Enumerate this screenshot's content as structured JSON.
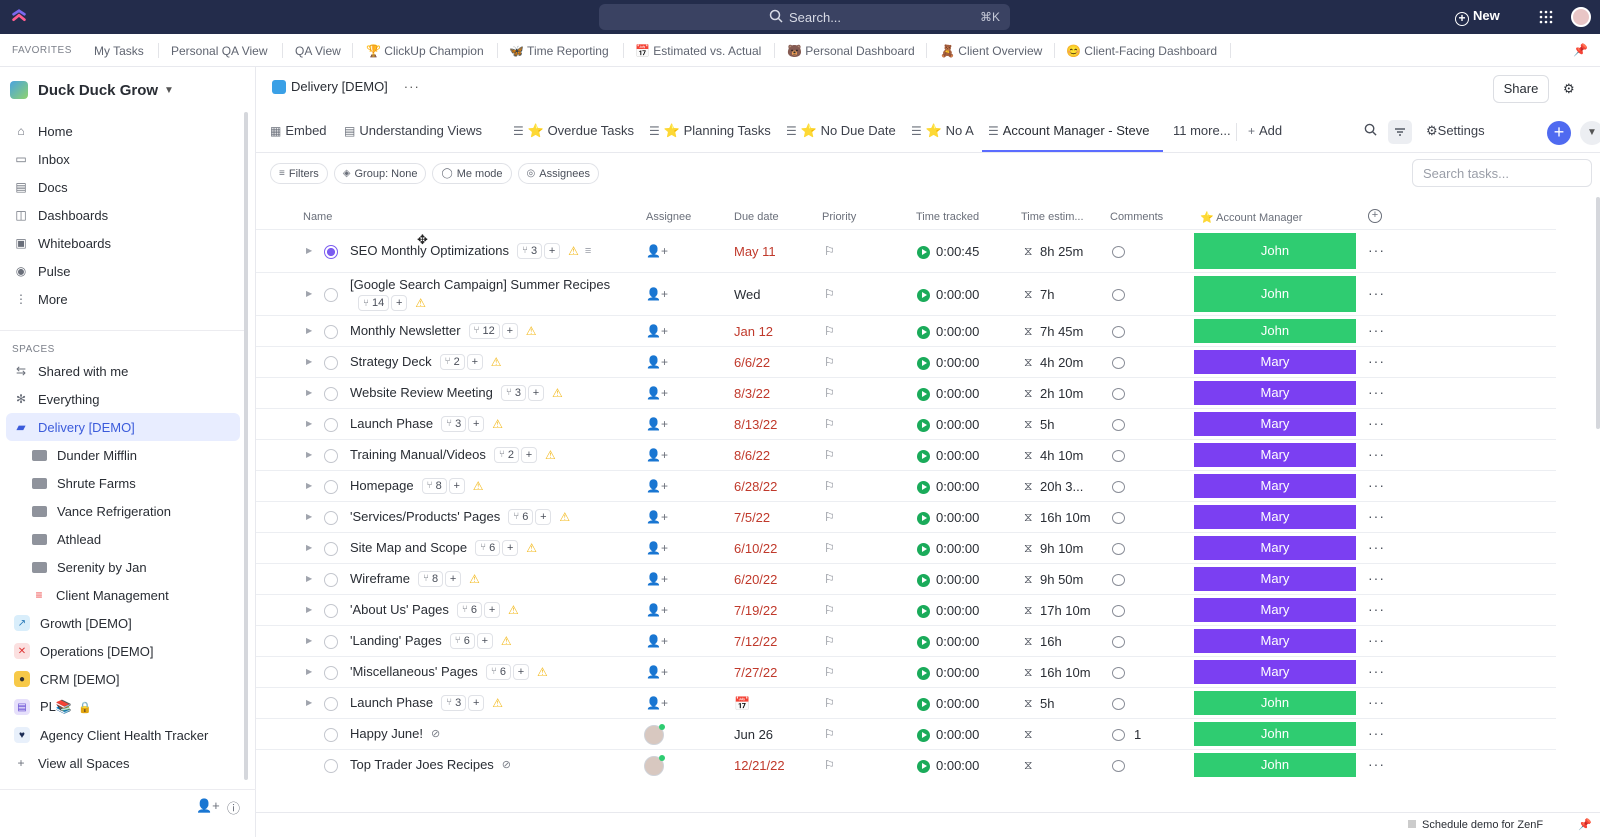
{
  "topbar": {
    "search_placeholder": "Search...",
    "search_shortcut": "⌘K",
    "new_label": "New"
  },
  "favorites": {
    "label": "FAVORITES",
    "items": [
      "My Tasks",
      "Personal QA View",
      "QA View",
      "🏆 ClickUp Champion",
      "🦋 Time Reporting",
      "📅 Estimated vs. Actual",
      "🐻 Personal Dashboard",
      "🧸 Client Overview",
      "😊 Client-Facing Dashboard"
    ]
  },
  "sidebar": {
    "workspace": "Duck Duck Grow",
    "nav": [
      "Home",
      "Inbox",
      "Docs",
      "Dashboards",
      "Whiteboards",
      "Pulse",
      "More"
    ],
    "spaces_label": "SPACES",
    "spaces": [
      "Shared with me",
      "Everything",
      "Delivery [DEMO]",
      "Dunder Mifflin",
      "Shrute Farms",
      "Vance Refrigeration",
      "Athlead",
      "Serenity by Jan",
      "Client Management",
      "Growth [DEMO]",
      "Operations [DEMO]",
      "CRM [DEMO]",
      "PL📚",
      "Agency Client Health Tracker",
      "View all Spaces"
    ]
  },
  "header": {
    "breadcrumb": "Delivery [DEMO]",
    "share_label": "Share"
  },
  "views": {
    "tabs": [
      "Embed",
      "Understanding Views",
      "⭐ Overdue Tasks",
      "⭐ Planning Tasks",
      "⭐ No Due Date",
      "⭐ No A",
      "Account Manager - Steve"
    ],
    "more": "11 more...",
    "add": "Add",
    "settings": "Settings"
  },
  "filters": [
    "Filters",
    "Group: None",
    "Me mode",
    "Assignees"
  ],
  "search_tasks_placeholder": "Search tasks...",
  "columns": [
    "Name",
    "Assignee",
    "Due date",
    "Priority",
    "Time tracked",
    "Time estim...",
    "Comments",
    "⭐ Account Manager"
  ],
  "colors": {
    "john": "#2fcc71",
    "mary": "#7b3ff2",
    "accent": "#5b6cff",
    "topbar": "#232c4b"
  },
  "rows": [
    {
      "name": "SEO Monthly Optimizations",
      "subtasks": "3",
      "due": "May 11",
      "tracked": "0:00:45",
      "estimate": "8h 25m",
      "manager": "John",
      "comments": ""
    },
    {
      "name": "[Google Search Campaign] Summer Recipes",
      "subtasks": "14",
      "due": "Wed",
      "tracked": "0:00:00",
      "estimate": "7h",
      "manager": "John",
      "comments": ""
    },
    {
      "name": "Monthly Newsletter",
      "subtasks": "12",
      "due": "Jan 12",
      "tracked": "0:00:00",
      "estimate": "7h 45m",
      "manager": "John",
      "comments": ""
    },
    {
      "name": "Strategy Deck",
      "subtasks": "2",
      "due": "6/6/22",
      "tracked": "0:00:00",
      "estimate": "4h 20m",
      "manager": "Mary",
      "comments": ""
    },
    {
      "name": "Website Review Meeting",
      "subtasks": "3",
      "due": "8/3/22",
      "tracked": "0:00:00",
      "estimate": "2h 10m",
      "manager": "Mary",
      "comments": ""
    },
    {
      "name": "Launch Phase",
      "subtasks": "3",
      "due": "8/13/22",
      "tracked": "0:00:00",
      "estimate": "5h",
      "manager": "Mary",
      "comments": ""
    },
    {
      "name": "Training Manual/Videos",
      "subtasks": "2",
      "due": "8/6/22",
      "tracked": "0:00:00",
      "estimate": "4h 10m",
      "manager": "Mary",
      "comments": ""
    },
    {
      "name": "Homepage",
      "subtasks": "8",
      "due": "6/28/22",
      "tracked": "0:00:00",
      "estimate": "20h 3...",
      "manager": "Mary",
      "comments": ""
    },
    {
      "name": "'Services/Products' Pages",
      "subtasks": "6",
      "due": "7/5/22",
      "tracked": "0:00:00",
      "estimate": "16h 10m",
      "manager": "Mary",
      "comments": ""
    },
    {
      "name": "Site Map and Scope",
      "subtasks": "6",
      "due": "6/10/22",
      "tracked": "0:00:00",
      "estimate": "9h 10m",
      "manager": "Mary",
      "comments": ""
    },
    {
      "name": "Wireframe",
      "subtasks": "8",
      "due": "6/20/22",
      "tracked": "0:00:00",
      "estimate": "9h 50m",
      "manager": "Mary",
      "comments": ""
    },
    {
      "name": "'About Us' Pages",
      "subtasks": "6",
      "due": "7/19/22",
      "tracked": "0:00:00",
      "estimate": "17h 10m",
      "manager": "Mary",
      "comments": ""
    },
    {
      "name": "'Landing' Pages",
      "subtasks": "6",
      "due": "7/12/22",
      "tracked": "0:00:00",
      "estimate": "16h",
      "manager": "Mary",
      "comments": ""
    },
    {
      "name": "'Miscellaneous' Pages",
      "subtasks": "6",
      "due": "7/27/22",
      "tracked": "0:00:00",
      "estimate": "16h 10m",
      "manager": "Mary",
      "comments": ""
    },
    {
      "name": "Launch Phase",
      "subtasks": "3",
      "due": "",
      "tracked": "0:00:00",
      "estimate": "5h",
      "manager": "John",
      "comments": ""
    },
    {
      "name": "Happy June!",
      "subtasks": "",
      "due": "Jun 26",
      "tracked": "0:00:00",
      "estimate": "",
      "manager": "John",
      "comments": "1"
    },
    {
      "name": "Top Trader Joes Recipes",
      "subtasks": "",
      "due": "12/21/22",
      "tracked": "0:00:00",
      "estimate": "",
      "manager": "John",
      "comments": ""
    }
  ],
  "footer": {
    "demo": "Schedule demo for ZenF"
  }
}
